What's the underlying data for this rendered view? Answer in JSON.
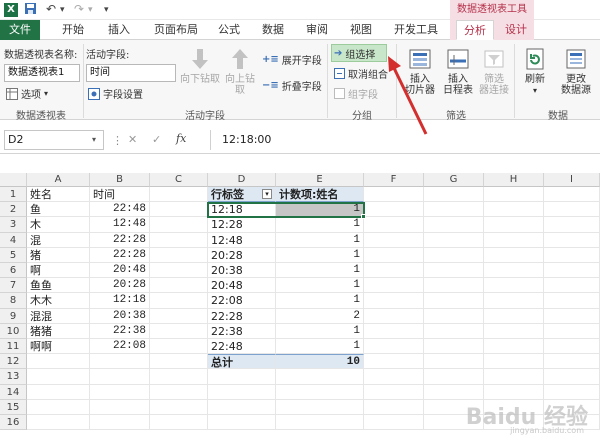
{
  "qa": {
    "excel_icon": "X",
    "undo": "↶",
    "redo": "↷",
    "more": "▾"
  },
  "ctx_title": "数据透视表工具",
  "tabs": [
    "文件",
    "开始",
    "插入",
    "页面布局",
    "公式",
    "数据",
    "审阅",
    "视图",
    "开发工具",
    "分析",
    "设计"
  ],
  "ribbon": {
    "pt_name_label": "数据透视表名称:",
    "pt_name_value": "数据透视表1",
    "options_label": "选项",
    "group1": "数据透视表",
    "active_field_label": "活动字段:",
    "active_field_value": "时间",
    "field_settings": "字段设置",
    "drill_down": "向下钻取",
    "drill_up_1": "向上钻",
    "drill_up_2": "取",
    "expand_field": "展开字段",
    "collapse_field": "折叠字段",
    "group2": "活动字段",
    "group_selection": "组选择",
    "ungroup": "取消组合",
    "group_field": "组字段",
    "group3": "分组",
    "insert_slicer_1": "插入",
    "insert_slicer_2": "切片器",
    "insert_timeline_1": "插入",
    "insert_timeline_2": "日程表",
    "filter_conn_1": "筛选",
    "filter_conn_2": "器连接",
    "group4": "筛选",
    "refresh": "刷新",
    "change_source_1": "更改",
    "change_source_2": "数据源",
    "group5": "数据"
  },
  "formula_bar": {
    "name_box": "D2",
    "formula": "12:18:00",
    "fx": "fx",
    "cancel": "✕",
    "enter": "✓"
  },
  "columns": [
    "A",
    "B",
    "C",
    "D",
    "E",
    "F",
    "G",
    "H",
    "I"
  ],
  "rows": [
    "1",
    "2",
    "3",
    "4",
    "5",
    "6",
    "7",
    "8",
    "9",
    "10",
    "11",
    "12",
    "13",
    "14",
    "15",
    "16"
  ],
  "data_table": {
    "header_a": "姓名",
    "header_b": "时间",
    "names": [
      "鱼",
      "木",
      "混",
      "猪",
      "啊",
      "鱼鱼",
      "木木",
      "混混",
      "猪猪",
      "啊啊"
    ],
    "times": [
      "22:48",
      "12:48",
      "22:28",
      "22:28",
      "20:48",
      "20:28",
      "12:18",
      "20:38",
      "22:38",
      "22:08"
    ]
  },
  "pivot": {
    "row_label": "行标签",
    "count_label": "计数项:姓名",
    "labels": [
      "12:18",
      "12:28",
      "12:48",
      "20:28",
      "20:38",
      "20:48",
      "22:08",
      "22:28",
      "22:38",
      "22:48"
    ],
    "counts": [
      "1",
      "1",
      "1",
      "1",
      "1",
      "1",
      "1",
      "2",
      "1",
      "1"
    ],
    "total_label": "总计",
    "total_value": "10"
  },
  "watermark": "Baidu 经验",
  "watermark_url": "jingyan.baidu.com",
  "colors": {
    "excel_green": "#217346",
    "context_pink": "#b4304a",
    "pivot_blue": "#dde8f3",
    "arrow_red": "#d32f2f"
  }
}
